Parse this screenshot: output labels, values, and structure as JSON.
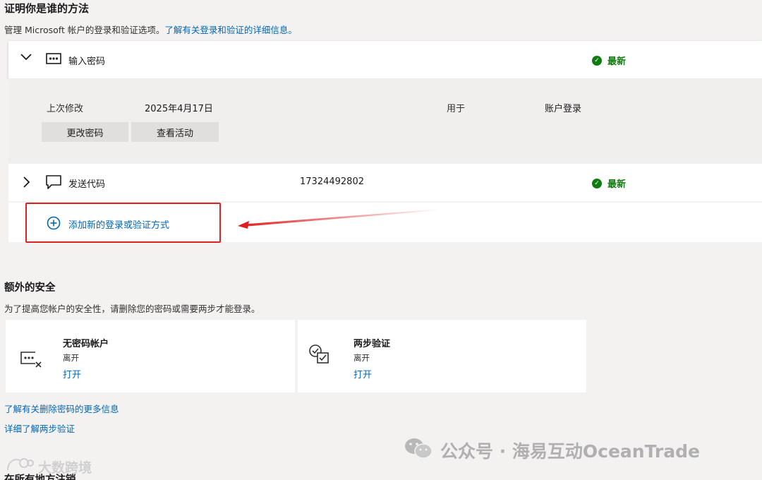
{
  "header": {
    "title": "证明你是谁的方法",
    "subtitle_text": "管理 Microsoft 帐户的登录和验证选项。",
    "subtitle_link": "了解有关登录和验证的详细信息。"
  },
  "methods": [
    {
      "label": "输入密码",
      "expand_icon": "chevron-down-icon",
      "icon": "password-dots-icon",
      "status": "最新",
      "status_color": "#107c10",
      "details": {
        "last_modified_label": "上次修改",
        "last_modified_value": "2025年4月17日",
        "used_for_label": "用于",
        "used_for_value": "账户登录",
        "buttons": [
          "更改密码",
          "查看活动"
        ]
      }
    },
    {
      "label": "发送代码",
      "expand_icon": "chevron-right-icon",
      "icon": "chat-bubble-icon",
      "value": "17324492802",
      "status": "最新"
    }
  ],
  "add_method": {
    "icon": "plus-circle-icon",
    "label": "添加新的登录或验证方式"
  },
  "annotation": {
    "highlight_color": "#e02020"
  },
  "extra_security": {
    "title": "额外的安全",
    "subtitle": "为了提高您帐户的安全性，请删除您的密码或需要两步才能登录。",
    "cards": [
      {
        "icon": "passwordless-icon",
        "title": "无密码帐户",
        "state": "离开",
        "action": "打开"
      },
      {
        "icon": "two-step-icon",
        "title": "两步验证",
        "state": "离开",
        "action": "打开"
      }
    ],
    "links": [
      "了解有关删除密码的更多信息",
      "详细了解两步验证"
    ]
  },
  "footer_partial_title": "在所有地方注销",
  "watermarks": {
    "right": "公众号 · 海易互动OceanTrade",
    "left": "大数跨境"
  }
}
